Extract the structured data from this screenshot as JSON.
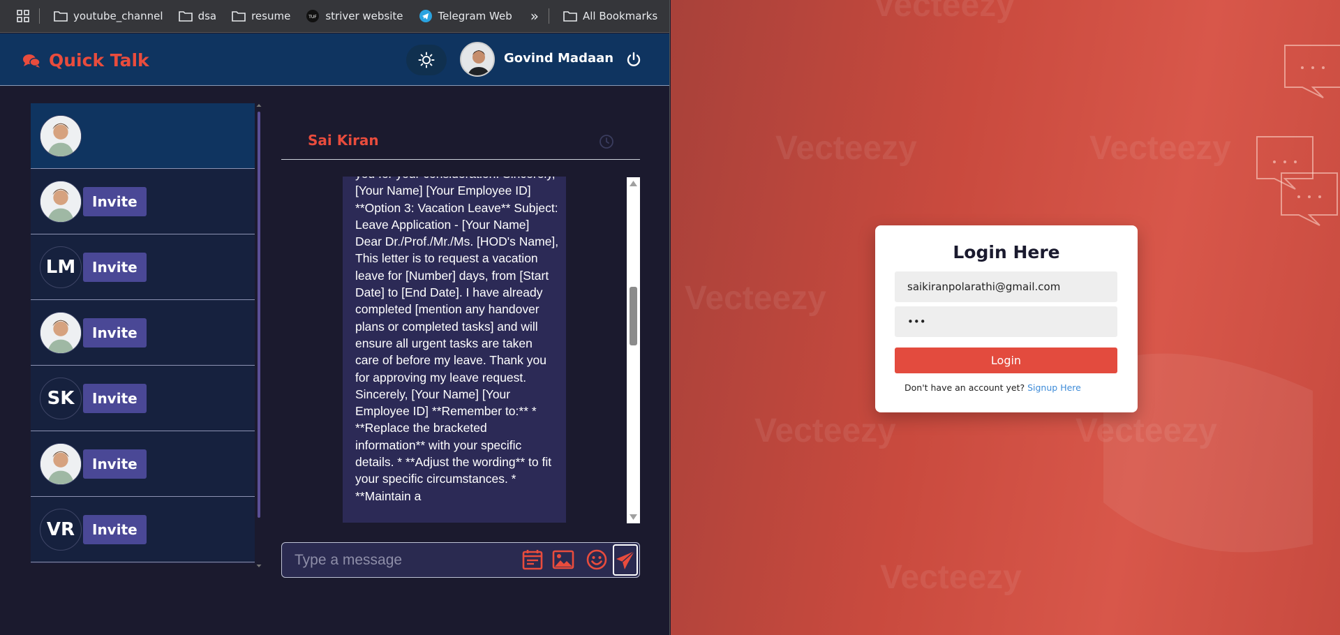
{
  "bookmarks": {
    "items": [
      {
        "label": "youtube_channel",
        "icon": "folder-icon"
      },
      {
        "label": "dsa",
        "icon": "folder-icon"
      },
      {
        "label": "resume",
        "icon": "folder-icon"
      },
      {
        "label": "striver website",
        "icon": "site-icon"
      },
      {
        "label": "Telegram Web",
        "icon": "telegram-icon"
      }
    ],
    "all_label": "All Bookmarks"
  },
  "header": {
    "brand": "Quick Talk",
    "user_name": "Govind Madaan"
  },
  "contacts": [
    {
      "avatar": "photo",
      "initials": "",
      "invite": "",
      "active": true
    },
    {
      "avatar": "photo",
      "initials": "",
      "invite": "Invite"
    },
    {
      "avatar": "initials",
      "initials": "LM",
      "invite": "Invite"
    },
    {
      "avatar": "photo",
      "initials": "",
      "invite": "Invite"
    },
    {
      "avatar": "initials",
      "initials": "SK",
      "invite": "Invite"
    },
    {
      "avatar": "photo",
      "initials": "",
      "invite": "Invite"
    },
    {
      "avatar": "initials",
      "initials": "VR",
      "invite": "Invite"
    }
  ],
  "chat": {
    "name": "Sai Kiran",
    "message": "you for your consideration. Sincerely, [Your Name] [Your Employee ID] **Option 3: Vacation Leave** Subject: Leave Application - [Your Name] Dear Dr./Prof./Mr./Ms. [HOD's Name], This letter is to request a vacation leave for [Number] days, from [Start Date] to [End Date]. I have already completed [mention any handover plans or completed tasks] and will ensure all urgent tasks are taken care of before my leave. Thank you for approving my leave request. Sincerely, [Your Name] [Your Employee ID] **Remember to:** * **Replace the bracketed information** with your specific details. * **Adjust the wording** to fit your specific circumstances. * **Maintain a",
    "input_placeholder": "Type a message"
  },
  "login": {
    "title": "Login Here",
    "email": "saikiranpolarathi@gmail.com",
    "password": "•••",
    "button": "Login",
    "prompt": "Don't have an account yet?",
    "signup_link": "Signup Here"
  },
  "watermark": "Vecteezy",
  "colors": {
    "accent": "#e94c3d",
    "appbar": "#0f3460",
    "invite": "#4a4896",
    "background": "#1b1a2e"
  }
}
